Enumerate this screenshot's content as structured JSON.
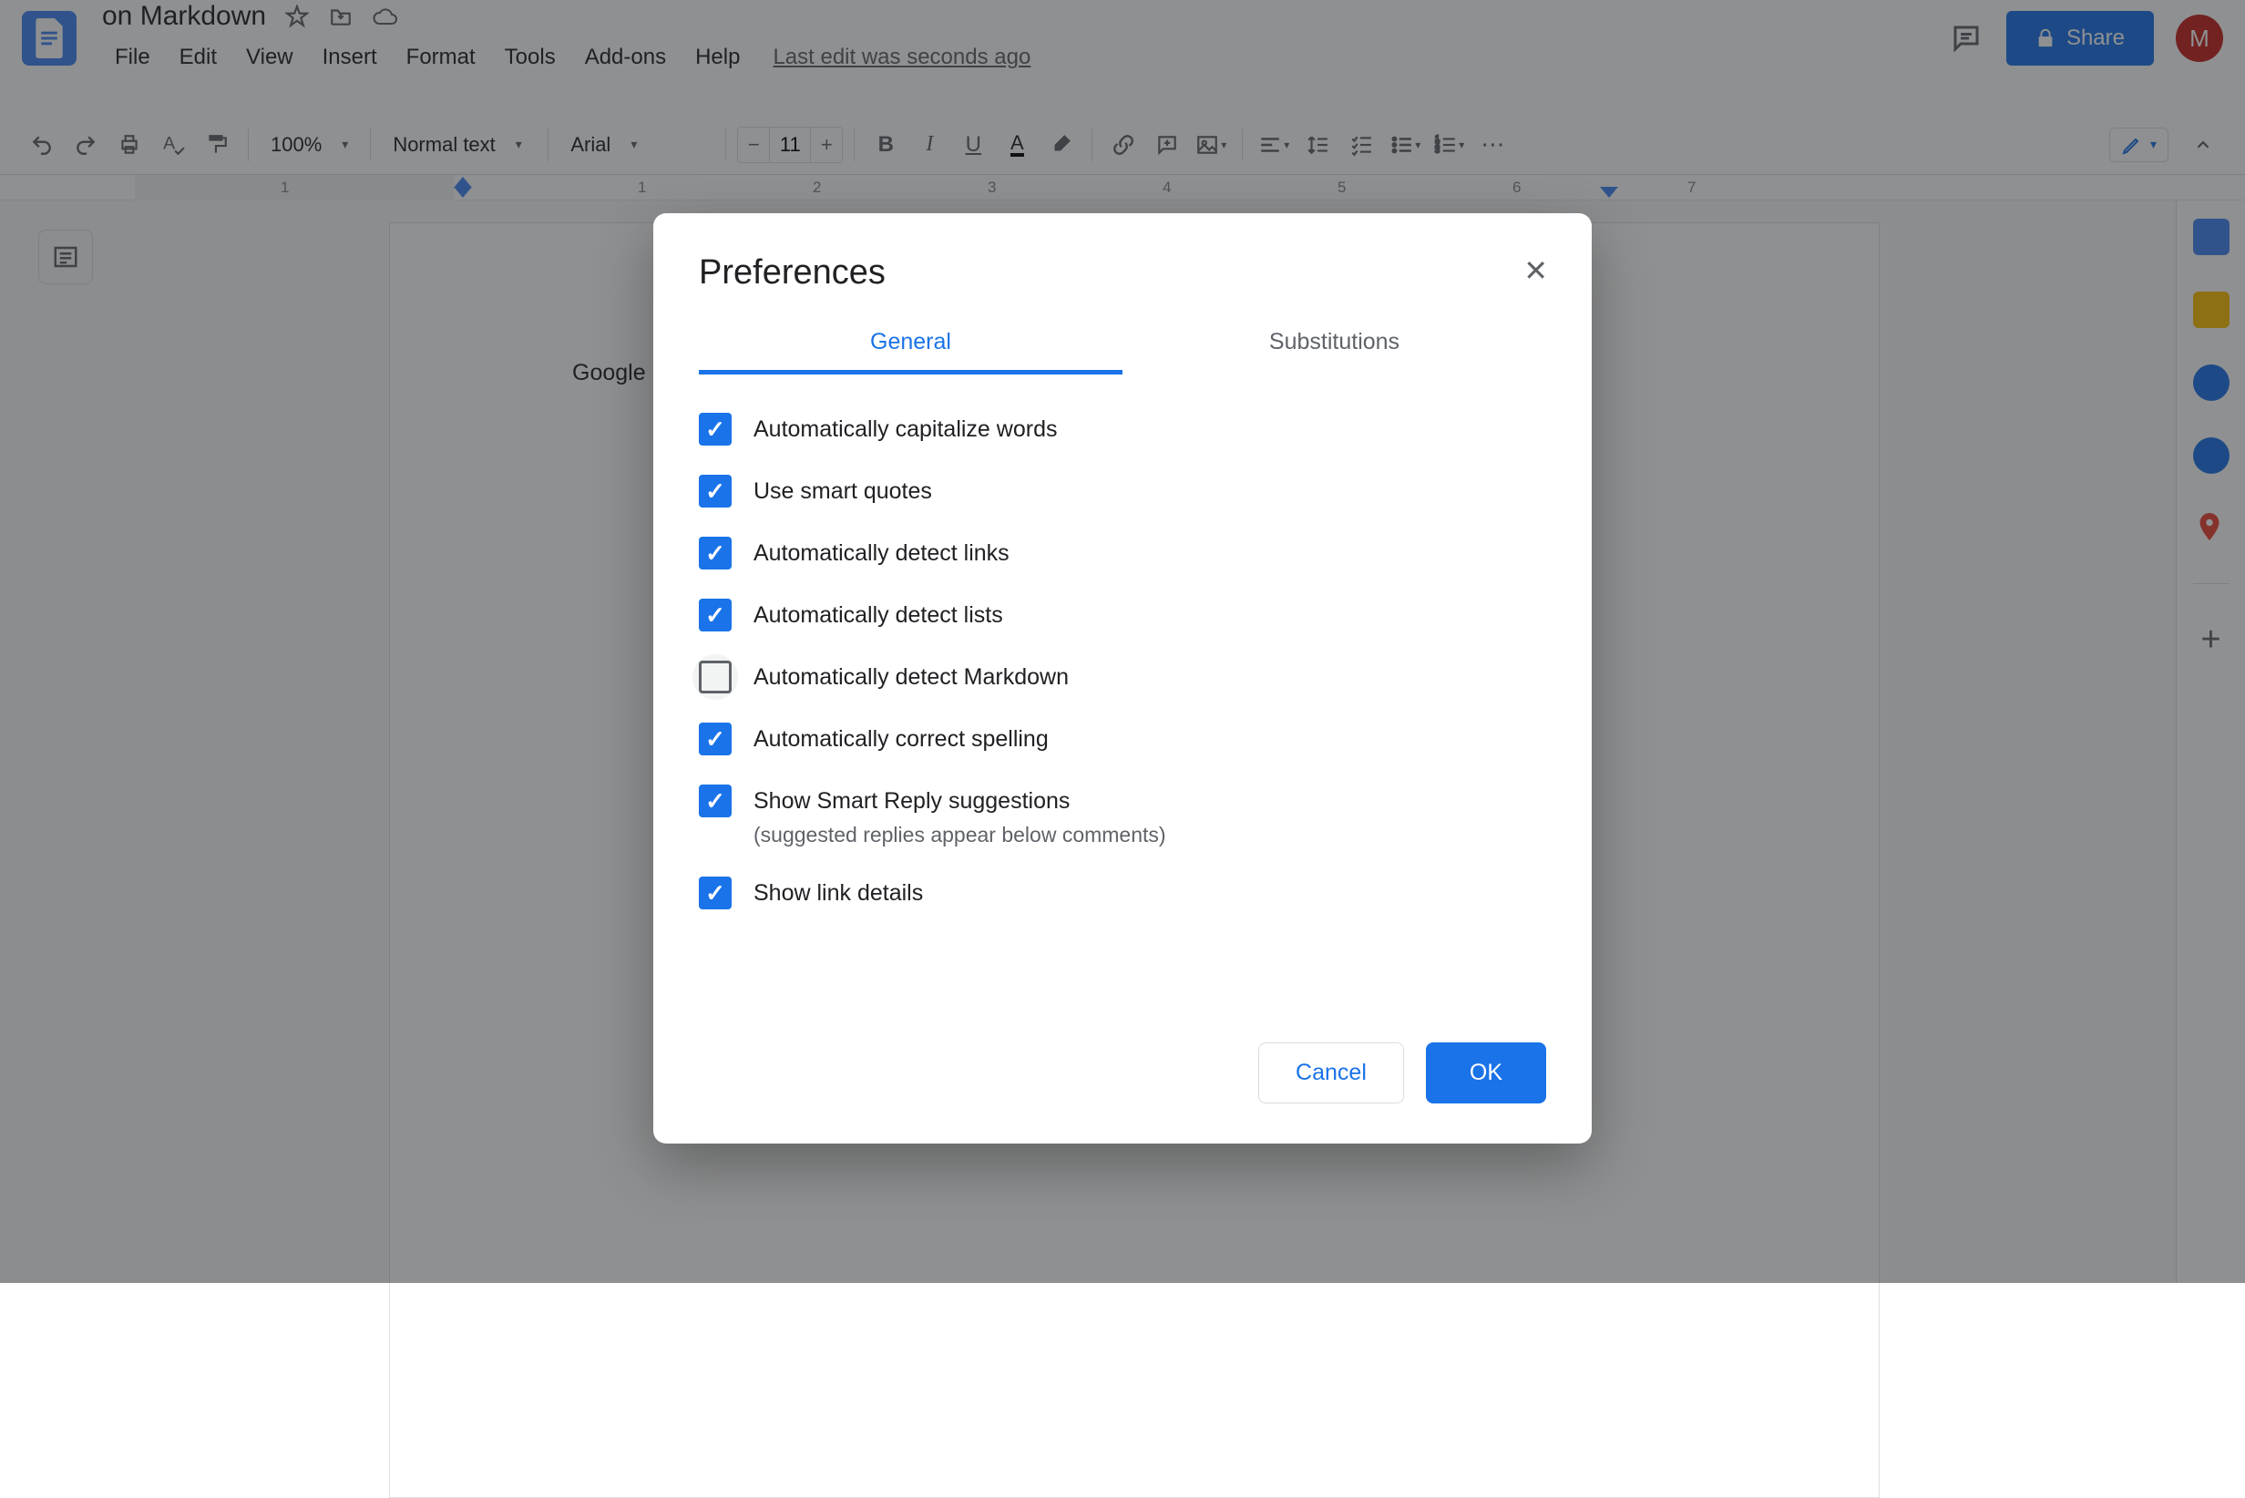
{
  "doc": {
    "title": "on Markdown",
    "last_edit": "Last edit was seconds ago",
    "body_text": "Google Docs is"
  },
  "menu": {
    "file": "File",
    "edit": "Edit",
    "view": "View",
    "insert": "Insert",
    "format": "Format",
    "tools": "Tools",
    "addons": "Add-ons",
    "help": "Help"
  },
  "header": {
    "share": "Share",
    "avatar_initial": "M"
  },
  "toolbar": {
    "zoom": "100%",
    "style": "Normal text",
    "font": "Arial",
    "font_size": "11"
  },
  "ruler": [
    "1",
    "1",
    "2",
    "3",
    "4",
    "5",
    "6",
    "7"
  ],
  "dialog": {
    "title": "Preferences",
    "tabs": {
      "general": "General",
      "substitutions": "Substitutions"
    },
    "prefs": [
      {
        "label": "Automatically capitalize words",
        "checked": true
      },
      {
        "label": "Use smart quotes",
        "checked": true
      },
      {
        "label": "Automatically detect links",
        "checked": true
      },
      {
        "label": "Automatically detect lists",
        "checked": true
      },
      {
        "label": "Automatically detect Markdown",
        "checked": false,
        "focused": true
      },
      {
        "label": "Automatically correct spelling",
        "checked": true
      },
      {
        "label": "Show Smart Reply suggestions",
        "checked": true,
        "sub": "(suggested replies appear below comments)"
      },
      {
        "label": "Show link details",
        "checked": true
      }
    ],
    "cancel": "Cancel",
    "ok": "OK"
  }
}
